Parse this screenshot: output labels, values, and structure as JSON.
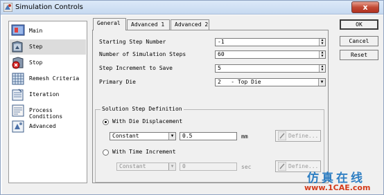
{
  "window": {
    "title": "Simulation Controls",
    "close_label": "x"
  },
  "sidebar": {
    "items": [
      {
        "label": "Main",
        "icon": "main-icon",
        "selected": false
      },
      {
        "label": "Step",
        "icon": "step-icon",
        "selected": true
      },
      {
        "label": "Stop",
        "icon": "stop-icon",
        "selected": false
      },
      {
        "label": "Remesh Criteria",
        "icon": "remesh-icon",
        "selected": false
      },
      {
        "label": "Iteration",
        "icon": "iteration-icon",
        "selected": false
      },
      {
        "label": "Process Conditions",
        "icon": "process-conditions-icon",
        "selected": false
      },
      {
        "label": "Advanced",
        "icon": "advanced-icon",
        "selected": false
      }
    ]
  },
  "tabs": [
    {
      "label": "General",
      "active": true
    },
    {
      "label": "Advanced 1",
      "active": false
    },
    {
      "label": "Advanced 2",
      "active": false
    }
  ],
  "general": {
    "starting_step_label": "Starting Step Number",
    "starting_step_value": "-1",
    "num_steps_label": "Number of Simulation Steps",
    "num_steps_value": "60",
    "increment_label": "Step Increment to Save",
    "increment_value": "5",
    "primary_die_label": "Primary Die",
    "primary_die_value": "2   - Top Die"
  },
  "solution_step": {
    "group_title": "Solution Step Definition",
    "die_disp_label": "With Die Displacement",
    "die_disp_selected": true,
    "die_disp_mode": "Constant",
    "die_disp_value": "0.5",
    "die_disp_unit": "mm",
    "define_label": "Define...",
    "time_inc_label": "With Time Increment",
    "time_inc_selected": false,
    "time_inc_mode": "Constant",
    "time_inc_value": "0",
    "time_inc_unit": "sec"
  },
  "buttons": {
    "ok": "OK",
    "cancel": "Cancel",
    "reset": "Reset"
  },
  "watermark": {
    "cn_text": "仿真在线",
    "url_text": "www.1CAE.com"
  },
  "colors": {
    "title_bar": "#c6d9f0",
    "close_button": "#c24a36",
    "dialog_bg": "#f0f0f0",
    "watermark_blue": "#2f7fc3",
    "watermark_red": "#d43a1a"
  }
}
